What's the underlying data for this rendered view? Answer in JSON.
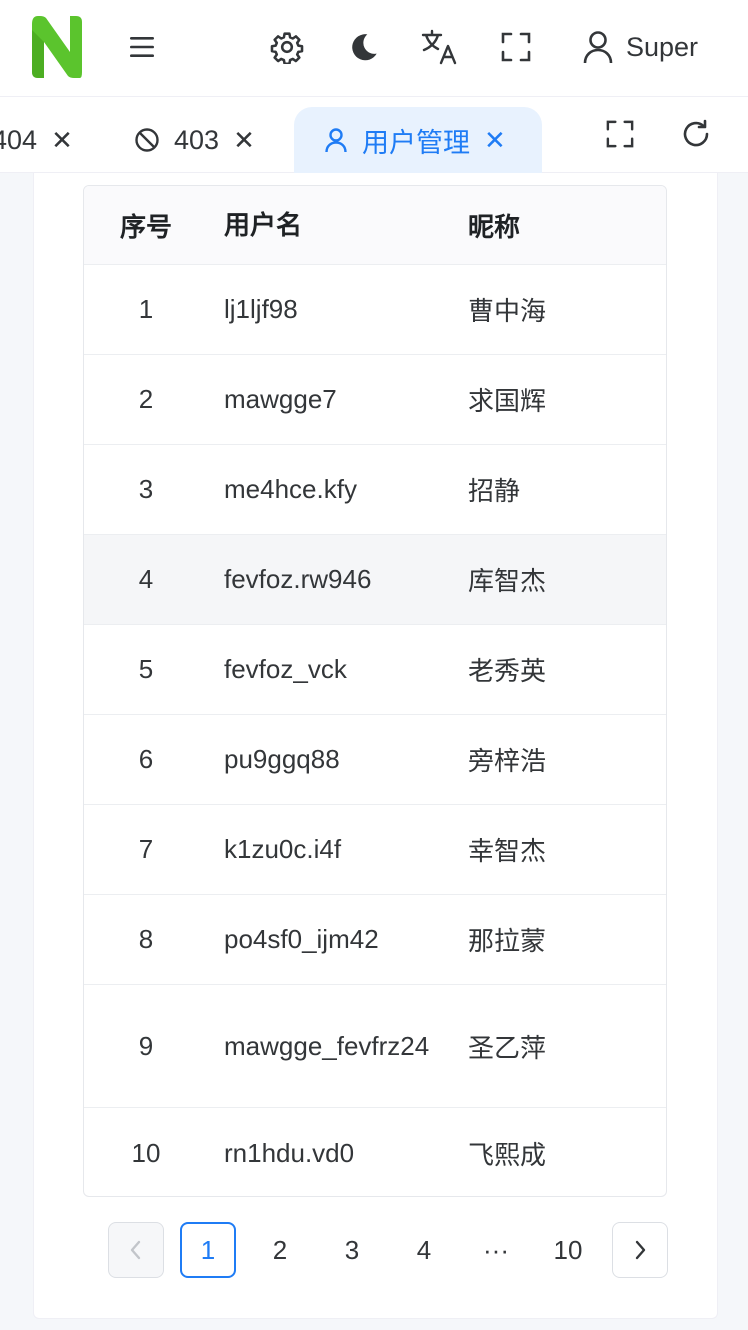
{
  "header": {
    "user_name": "Super",
    "icons": [
      "menu-icon",
      "gear-icon",
      "moon-icon",
      "translate-icon",
      "fullscreen-icon",
      "user-icon"
    ]
  },
  "tabs": [
    {
      "label": "404",
      "icon": null,
      "active": false
    },
    {
      "label": "403",
      "icon": "forbidden-icon",
      "active": false
    },
    {
      "label": "用户管理",
      "icon": "user-icon",
      "active": true
    }
  ],
  "tab_close_glyph": "✕",
  "table": {
    "columns": [
      "序号",
      "用户名",
      "昵称"
    ],
    "rows": [
      {
        "idx": "1",
        "username": "lj1ljf98",
        "nickname": "曹中海"
      },
      {
        "idx": "2",
        "username": "mawgge7",
        "nickname": "求国辉"
      },
      {
        "idx": "3",
        "username": "me4hce.kfy",
        "nickname": "招静"
      },
      {
        "idx": "4",
        "username": "fevfoz.rw946",
        "nickname": "库智杰"
      },
      {
        "idx": "5",
        "username": "fevfoz_vck",
        "nickname": "老秀英"
      },
      {
        "idx": "6",
        "username": "pu9ggq88",
        "nickname": "旁梓浩"
      },
      {
        "idx": "7",
        "username": "k1zu0c.i4f",
        "nickname": "幸智杰"
      },
      {
        "idx": "8",
        "username": "po4sf0_ijm42",
        "nickname": "那拉蒙"
      },
      {
        "idx": "9",
        "username": "mawgge_fevfrz24",
        "nickname": "圣乙萍"
      },
      {
        "idx": "10",
        "username": "rn1hdu.vd0",
        "nickname": "飞熙成"
      }
    ]
  },
  "pagination": {
    "pages": [
      "1",
      "2",
      "3",
      "4",
      "···",
      "10"
    ],
    "current": "1"
  },
  "colors": {
    "accent": "#1f7cf5",
    "logo_green": "#5bc42d",
    "active_tab_bg": "#e8f2fe"
  }
}
